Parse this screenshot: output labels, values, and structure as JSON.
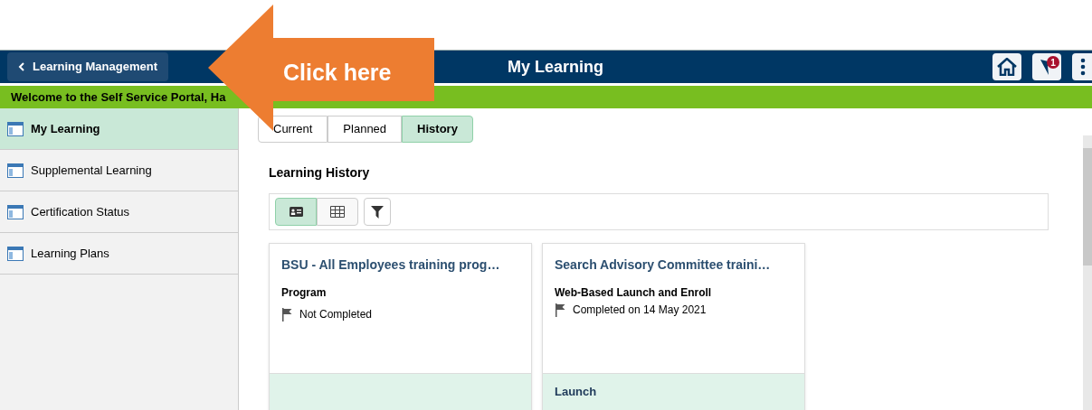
{
  "header": {
    "back_button": "Learning Management",
    "title": "My Learning",
    "notification_count": "1"
  },
  "welcome": "Welcome to the Self Service Portal, Ha",
  "sidebar": {
    "items": [
      {
        "label": "My Learning",
        "selected": true
      },
      {
        "label": "Supplemental Learning",
        "selected": false
      },
      {
        "label": "Certification Status",
        "selected": false
      },
      {
        "label": "Learning Plans",
        "selected": false
      }
    ]
  },
  "tabs": [
    {
      "label": "Current",
      "selected": false
    },
    {
      "label": "Planned",
      "selected": false
    },
    {
      "label": "History",
      "selected": true
    }
  ],
  "section_title": "Learning History",
  "view_toggle": [
    {
      "kind": "cards",
      "selected": true
    },
    {
      "kind": "grid",
      "selected": false
    }
  ],
  "cards": [
    {
      "title": "BSU - All Employees training prog…",
      "type": "Program",
      "status": "Not Completed"
    },
    {
      "title": "Search Advisory Committee traini…",
      "type": "Web-Based Launch and Enroll",
      "status": "Completed on 14 May 2021",
      "action": "Launch"
    }
  ],
  "callout": {
    "text": "Click here"
  }
}
